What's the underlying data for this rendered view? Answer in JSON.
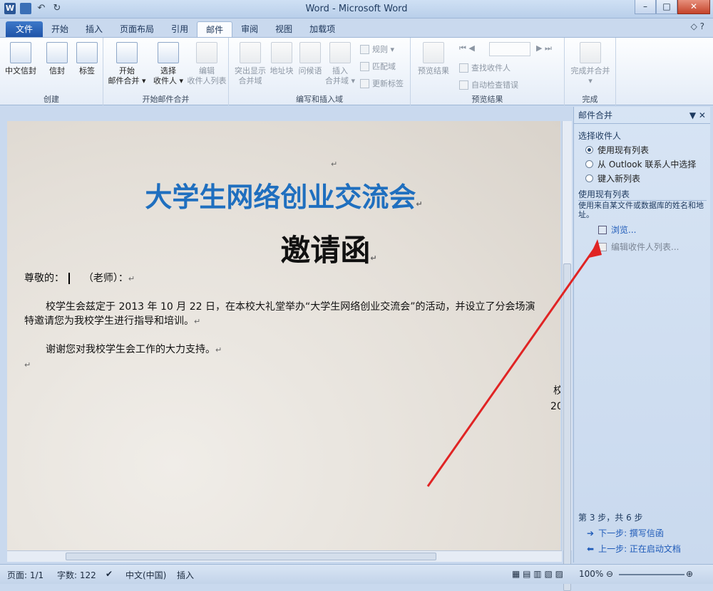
{
  "window": {
    "title": "Word - Microsoft Word",
    "app_icon": "W"
  },
  "tabs": [
    "文件",
    "开始",
    "插入",
    "页面布局",
    "引用",
    "邮件",
    "审阅",
    "视图",
    "加载项"
  ],
  "active_tab": "邮件",
  "ribbon": {
    "groups": [
      {
        "label": "创建",
        "buttons": [
          "中文信封",
          "信封",
          "标签"
        ]
      },
      {
        "label": "开始邮件合并",
        "buttons": [
          "开始\n邮件合并 ▾",
          "选择\n收件人 ▾",
          "编辑\n收件人列表"
        ]
      },
      {
        "label": "编写和插入域",
        "buttons": [
          "突出显示\n合并域",
          "地址块",
          "问候语",
          "插入\n合并域 ▾"
        ],
        "small": [
          "规则 ▾",
          "匹配域",
          "更新标签"
        ]
      },
      {
        "label": "预览结果",
        "buttons": [
          "预览结果"
        ],
        "small": [
          "查找收件人",
          "自动检查错误"
        ]
      },
      {
        "label": "完成",
        "buttons": [
          "完成并合并\n▾"
        ]
      }
    ]
  },
  "document": {
    "title": "大学生网络创业交流会",
    "subtitle": "邀请函",
    "greeting": "尊敬的：",
    "greeting_suffix": "（老师）：",
    "body1": "校学生会兹定于 2013 年 10 月 22 日，在本校大礼堂举办“大学生网络创业交流会”的活动，并设立了分会场演",
    "body2": "特邀请您为我校学生进行指导和培训。",
    "body3": "谢谢您对我校学生会工作的大力支持。",
    "sign1": "校",
    "sign2": "20",
    "mark": "↵"
  },
  "pane": {
    "title": "邮件合并",
    "section1": "选择收件人",
    "options": [
      "使用现有列表",
      "从 Outlook 联系人中选择",
      "键入新列表"
    ],
    "section2": "使用现有列表",
    "desc": "使用来自某文件或数据库的姓名和地址。",
    "browse": "浏览...",
    "edit": "编辑收件人列表...",
    "step": "第 3 步，共 6 步",
    "next": "下一步: 撰写信函",
    "prev": "上一步: 正在启动文档"
  },
  "status": {
    "page": "页面: 1/1",
    "words": "字数: 122",
    "lang": "中文(中国)",
    "mode": "插入",
    "zoom": "100%"
  }
}
